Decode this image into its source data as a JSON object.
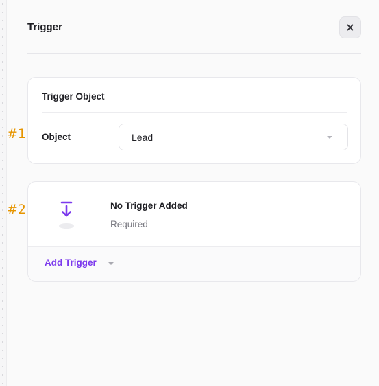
{
  "panel": {
    "title": "Trigger"
  },
  "trigger_object": {
    "section_title": "Trigger Object",
    "field_label": "Object",
    "selected_value": "Lead"
  },
  "trigger": {
    "empty_title": "No Trigger Added",
    "empty_subtitle": "Required",
    "add_label": "Add Trigger"
  },
  "annotations": {
    "marker_1": "#1",
    "marker_2": "#2"
  },
  "icons": {
    "close": "close-icon",
    "dropdown": "chevron-down-icon",
    "trigger": "arrow-down-to-line-icon"
  },
  "colors": {
    "accent": "#7c3aed",
    "marker": "#e69500",
    "text_primary": "#1f1f24",
    "text_secondary": "#7a7a82"
  }
}
